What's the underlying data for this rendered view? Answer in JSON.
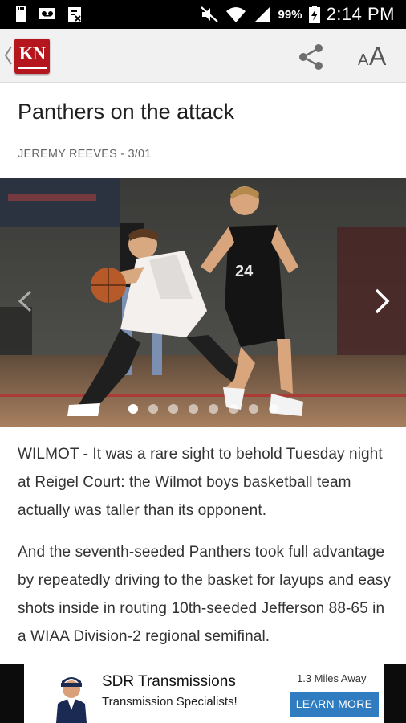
{
  "status_bar": {
    "battery_percent": "99%",
    "time": "2:14 PM",
    "icons": [
      "sd-card-icon",
      "voicemail-icon",
      "clipboard-icon",
      "mute-icon",
      "wifi-icon",
      "signal-icon",
      "battery-charging-icon"
    ]
  },
  "app_bar": {
    "logo_text": "KN",
    "icons": [
      "back-chevron-icon",
      "share-icon",
      "text-size-icon"
    ],
    "text_size": {
      "small": "A",
      "large": "A"
    }
  },
  "article": {
    "headline": "Panthers on the attack",
    "byline": "JEREMY REEVES - 3/01",
    "paragraphs": [
      "WILMOT - It was a rare sight to behold Tuesday night at Reigel Court: the Wilmot boys basketball team actually was taller than its opponent.",
      "And the seventh-seeded Panthers took full advantage by repeatedly driving to the basket for layups and easy shots inside in routing 10th-seeded Jefferson 88-65 in a WIAA Division-2 regional semifinal."
    ]
  },
  "carousel": {
    "slide_count": 8,
    "active_index": 0,
    "jersey_number": "24"
  },
  "ad": {
    "title": "SDR Transmissions",
    "subtitle": "Transmission Specialists!",
    "distance": "1.3 Miles Away",
    "cta": "LEARN MORE"
  },
  "colors": {
    "brand_red": "#b5161e",
    "cta_blue": "#2f7cc0"
  }
}
